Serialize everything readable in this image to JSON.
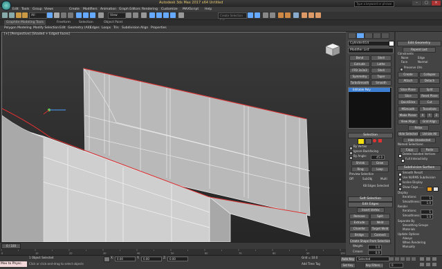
{
  "title_bar": {
    "title": "Autodesk 3ds Max 2017 x64    Untitled",
    "search_placeholder": "Type a keyword or phrase",
    "minimize": "–",
    "maximize": "□",
    "close": "×"
  },
  "menu": [
    "Edit",
    "Tools",
    "Group",
    "Views",
    "Create",
    "Modifiers",
    "Animation",
    "Graph Editors",
    "Rendering",
    "Customize",
    "MAXScript",
    "Help"
  ],
  "toolbar": {
    "filter": "All",
    "view": "View",
    "selection_set": "Create Selection Set"
  },
  "ribbon": {
    "tabs": [
      "Graphite Modeling Tools",
      "Freeform",
      "Selection",
      "Object Paint"
    ],
    "subtabs": [
      "Polygon Modeling",
      "Modify Selection",
      "Edit",
      "Geometry (All)",
      "Edges",
      "Loops",
      "Tris",
      "Subdivision",
      "Align",
      "Properties"
    ]
  },
  "viewport": {
    "label": "[+] [Perspective] [Shaded + Edged Faces]"
  },
  "command_panel": {
    "object_name": "Cylinder014",
    "modifier_list": "Modifier List",
    "modifier_buttons": [
      [
        "Bend",
        "Shell"
      ],
      [
        "Extrude",
        "Lathe"
      ],
      [
        "FFD 3x3x3",
        "Shell"
      ],
      [
        "Symmetry",
        "Taper"
      ],
      [
        "TurboSmooth",
        "Smooth"
      ]
    ],
    "stack_item": "Editable Poly",
    "selection": {
      "header": "Selection",
      "by_vertex": "By Vertex",
      "ignore_backfacing": "Ignore Backfacing",
      "by_angle": "By Angle:",
      "angle_value": "45.0",
      "shrink": "Shrink",
      "grow": "Grow",
      "ring": "Ring",
      "loop": "Loop",
      "preview_selection": "Preview Selection",
      "preview_options": [
        "Off",
        "SubObj",
        "Multi"
      ],
      "status": "68 Edges Selected"
    },
    "soft_selection": "Soft Selection",
    "edit_edges": {
      "header": "Edit Edges",
      "insert_vertex": "Insert Vertex",
      "rows": [
        [
          "Remove",
          "Split"
        ],
        [
          "Extrude",
          "Weld"
        ],
        [
          "Chamfer",
          "Target Weld"
        ],
        [
          "Bridge",
          "Connect"
        ]
      ],
      "create_shape": "Create Shape From Selection",
      "weight_label": "Weight:",
      "weight_value": "1.0",
      "crease_label": "Crease:",
      "crease_value": "0.0"
    }
  },
  "edit_geometry": {
    "header": "Edit Geometry",
    "repeat_last": "Repeat Last",
    "constraints": "Constraints",
    "constraint_options": [
      "None",
      "Edge",
      "Face",
      "Normal"
    ],
    "preserve_uvs": "Preserve UVs",
    "create": "Create",
    "collapse": "Collapse",
    "attach": "Attach",
    "detach": "Detach",
    "slice_plane": "Slice Plane",
    "split": "Split",
    "slice": "Slice",
    "reset_plane": "Reset Plane",
    "quickslice": "QuickSlice",
    "cut": "Cut",
    "msmooth": "MSmooth",
    "tessellate": "Tessellate",
    "make_planar": "Make Planar",
    "xyz": [
      "X",
      "Y",
      "Z"
    ],
    "view_align": "View Align",
    "grid_align": "Grid Align",
    "relax": "Relax",
    "hide_selected": "Hide Selected",
    "unhide_all": "Unhide All",
    "hide_unselected": "Hide Unselected",
    "named_selections": "Named Selections:",
    "copy": "Copy",
    "paste": "Paste",
    "delete_isolated": "Delete Isolated Vertices",
    "full_interactivity": "Full Interactivity",
    "subdivision_header": "Subdivision Surface",
    "smooth_result": "Smooth Result",
    "use_nurms": "Use NURMS Subdivision",
    "isoline": "Isoline Display",
    "show_cage": "Show Cage......",
    "display": "Display",
    "iterations_label": "Iterations:",
    "iterations_value": "1",
    "smoothness_label": "Smoothness:",
    "smoothness_value": "1.0",
    "render": "Render",
    "separate_by": "Separate By",
    "smoothing_groups": "Smoothing Groups",
    "materials": "Materials",
    "update_options": "Update Options",
    "always": "Always",
    "when_rendering": "When Rendering",
    "manually": "Manually"
  },
  "timeline": {
    "frame": "0 / 100",
    "ticks": [
      "0",
      "10",
      "20",
      "30",
      "40",
      "50",
      "60",
      "70",
      "80",
      "90",
      "100"
    ]
  },
  "status": {
    "maxscript": "Max to Physc.",
    "selected": "1 Object Selected",
    "prompt": "Click or click-and-drag to select objects",
    "x_label": "X:",
    "x_value": "0.00",
    "y_label": "Y:",
    "y_value": "0.00",
    "z_label": "Z:",
    "z_value": "0.00",
    "grid": "Grid = 10.0",
    "add_time_tag": "Add Time Tag",
    "auto_key": "Auto Key",
    "set_key": "Set Key",
    "selected_dropdown": "Selected",
    "key_filters": "Key Filters...",
    "frame_value": "0"
  },
  "colors": {
    "accent": "#3c7fd2",
    "selected_edges": "#d83030",
    "vertex_green": "#66dd44",
    "gizmo_blue": "#4aa0ff"
  }
}
